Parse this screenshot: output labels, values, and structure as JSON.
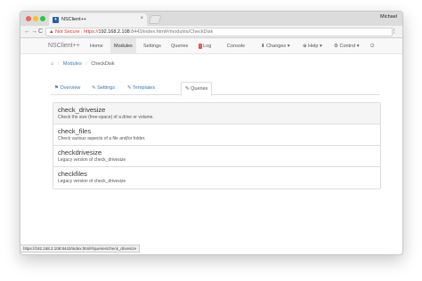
{
  "browser": {
    "tab_title": "NSClient++",
    "tab_favicon_glyph": "+",
    "tab_close": "×",
    "user_name": "Michael",
    "security_label": "Not Secure",
    "url_scheme": "https://",
    "url_host": "192.168.2.108",
    "url_path": ":8443/index.html#/modules/CheckDisk",
    "status_url": "https://192.168.2.108:8443/index.html#/queries/check_drivesize",
    "back_glyph": "←",
    "forward_glyph": "→",
    "reload_glyph": "C",
    "menu_glyph": "⋮"
  },
  "navbar": {
    "brand": "NSClient++",
    "items": [
      {
        "label": "Home"
      },
      {
        "label": "Modules"
      },
      {
        "label": "Settings"
      },
      {
        "label": "Queries"
      },
      {
        "label": "Log"
      },
      {
        "label": "Console"
      }
    ],
    "changes_label": "Changes",
    "help_label": "Help",
    "control_label": "Control",
    "log_badge_glyph": "!",
    "logout_glyph": "⏻"
  },
  "breadcrumb": {
    "home_glyph": "⌂",
    "modules": "Modules",
    "current": "CheckDisk",
    "separator": "/"
  },
  "subtabs": [
    {
      "label": "Overview",
      "glyph": "⚑"
    },
    {
      "label": "Settings",
      "glyph": "✎"
    },
    {
      "label": "Templates",
      "glyph": "✎"
    },
    {
      "label": "Queries",
      "glyph": "✎"
    }
  ],
  "queries": [
    {
      "name": "check_drivesize",
      "description": "Check the size (free-space) of a drive or volume."
    },
    {
      "name": "check_files",
      "description": "Check various aspects of a file and/or folder."
    },
    {
      "name": "checkdrivesize",
      "description": "Legacy version of check_drivesize"
    },
    {
      "name": "checkfiles",
      "description": "Legacy version of check_drivesize"
    }
  ],
  "colors": {
    "link": "#337ab7",
    "danger": "#d9534f",
    "not_secure": "#d93025"
  }
}
